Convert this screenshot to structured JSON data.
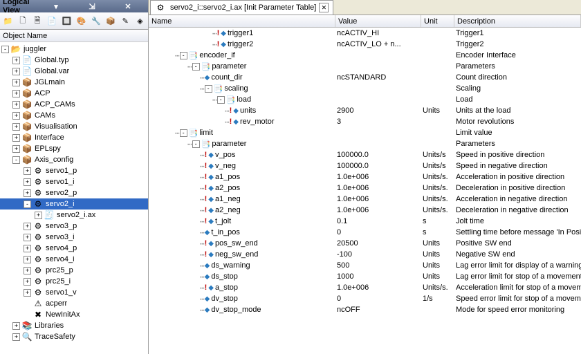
{
  "left": {
    "title": "Logical View",
    "headerTitle": "Object Name",
    "toolbarIcons": [
      "📁",
      "🗋",
      "🗎",
      "📄",
      "🔲",
      "🎨",
      "🔧",
      "📦",
      "✎",
      "◈"
    ],
    "tree": [
      {
        "depth": 0,
        "exp": "-",
        "kind": "folder",
        "label": "juggler"
      },
      {
        "depth": 1,
        "exp": "+",
        "kind": "file",
        "label": "Global.typ"
      },
      {
        "depth": 1,
        "exp": "+",
        "kind": "file",
        "label": "Global.var"
      },
      {
        "depth": 1,
        "exp": "+",
        "kind": "pkg",
        "label": "JGLmain"
      },
      {
        "depth": 1,
        "exp": "+",
        "kind": "pkg",
        "label": "ACP"
      },
      {
        "depth": 1,
        "exp": "+",
        "kind": "pkg",
        "label": "ACP_CAMs"
      },
      {
        "depth": 1,
        "exp": "+",
        "kind": "pkg",
        "label": "CAMs"
      },
      {
        "depth": 1,
        "exp": "+",
        "kind": "pkg",
        "label": "Visualisation"
      },
      {
        "depth": 1,
        "exp": "+",
        "kind": "pkg",
        "label": "Interface"
      },
      {
        "depth": 1,
        "exp": "+",
        "kind": "pkg",
        "label": "EPLspy"
      },
      {
        "depth": 1,
        "exp": "-",
        "kind": "pkg",
        "label": "Axis_config"
      },
      {
        "depth": 2,
        "exp": "+",
        "kind": "axis-p",
        "label": "servo1_p"
      },
      {
        "depth": 2,
        "exp": "+",
        "kind": "axis-i",
        "label": "servo1_i"
      },
      {
        "depth": 2,
        "exp": "+",
        "kind": "axis-p",
        "label": "servo2_p"
      },
      {
        "depth": 2,
        "exp": "-",
        "kind": "axis-i",
        "label": "servo2_i",
        "sel": true
      },
      {
        "depth": 3,
        "exp": "+",
        "kind": "ax",
        "label": "servo2_i.ax"
      },
      {
        "depth": 2,
        "exp": "+",
        "kind": "axis-p",
        "label": "servo3_p"
      },
      {
        "depth": 2,
        "exp": "+",
        "kind": "axis-i",
        "label": "servo3_i"
      },
      {
        "depth": 2,
        "exp": "+",
        "kind": "axis-p",
        "label": "servo4_p"
      },
      {
        "depth": 2,
        "exp": "+",
        "kind": "axis-i",
        "label": "servo4_i"
      },
      {
        "depth": 2,
        "exp": "+",
        "kind": "axis-p",
        "label": "prc25_p"
      },
      {
        "depth": 2,
        "exp": "+",
        "kind": "axis-i",
        "label": "prc25_i"
      },
      {
        "depth": 2,
        "exp": "+",
        "kind": "axis-i",
        "label": "servo1_v"
      },
      {
        "depth": 2,
        "exp": "",
        "kind": "warn",
        "label": "acperr"
      },
      {
        "depth": 2,
        "exp": "",
        "kind": "err",
        "label": "NewInitAx"
      },
      {
        "depth": 1,
        "exp": "+",
        "kind": "lib",
        "label": "Libraries"
      },
      {
        "depth": 1,
        "exp": "+",
        "kind": "trace",
        "label": "TraceSafety"
      }
    ]
  },
  "right": {
    "tabTitle": "servo2_i::servo2_i.ax [Init Parameter Table]",
    "columns": {
      "name": "Name",
      "value": "Value",
      "unit": "Unit",
      "desc": "Description"
    },
    "rows": [
      {
        "ind": 5,
        "mark": "!",
        "type": "val",
        "name": "trigger1",
        "value": "ncACTIV_HI",
        "unit": "",
        "desc": "Trigger1"
      },
      {
        "ind": 5,
        "mark": "!",
        "type": "val",
        "name": "trigger2",
        "value": "ncACTIV_LO + n...",
        "unit": "",
        "desc": "Trigger2"
      },
      {
        "ind": 2,
        "mark": "",
        "type": "struct",
        "exp": "-",
        "name": "encoder_if",
        "value": "",
        "unit": "",
        "desc": "Encoder Interface"
      },
      {
        "ind": 3,
        "mark": "",
        "type": "struct",
        "exp": "-",
        "name": "parameter",
        "value": "",
        "unit": "",
        "desc": "Parameters"
      },
      {
        "ind": 4,
        "mark": "",
        "type": "val",
        "name": "count_dir",
        "value": "ncSTANDARD",
        "unit": "",
        "desc": "Count direction"
      },
      {
        "ind": 4,
        "mark": "",
        "type": "struct",
        "exp": "-",
        "name": "scaling",
        "value": "",
        "unit": "",
        "desc": "Scaling"
      },
      {
        "ind": 5,
        "mark": "",
        "type": "struct",
        "exp": "-",
        "name": "load",
        "value": "",
        "unit": "",
        "desc": "Load"
      },
      {
        "ind": 6,
        "mark": "!",
        "type": "val",
        "name": "units",
        "value": "2900",
        "unit": "Units",
        "desc": "Units at the load"
      },
      {
        "ind": 6,
        "mark": "!",
        "type": "val",
        "name": "rev_motor",
        "value": "3",
        "unit": "",
        "desc": "Motor revolutions"
      },
      {
        "ind": 2,
        "mark": "",
        "type": "struct",
        "exp": "-",
        "name": "limit",
        "value": "",
        "unit": "",
        "desc": "Limit value"
      },
      {
        "ind": 3,
        "mark": "",
        "type": "struct",
        "exp": "-",
        "name": "parameter",
        "value": "",
        "unit": "",
        "desc": "Parameters"
      },
      {
        "ind": 4,
        "mark": "!",
        "type": "val",
        "name": "v_pos",
        "value": "100000.0",
        "unit": "Units/s",
        "desc": "Speed in positive direction"
      },
      {
        "ind": 4,
        "mark": "!",
        "type": "val",
        "name": "v_neg",
        "value": "100000.0",
        "unit": "Units/s",
        "desc": "Speed in negative direction"
      },
      {
        "ind": 4,
        "mark": "!",
        "type": "val",
        "name": "a1_pos",
        "value": "1.0e+006",
        "unit": "Units/s.",
        "desc": "Acceleration in positive direction"
      },
      {
        "ind": 4,
        "mark": "!",
        "type": "val",
        "name": "a2_pos",
        "value": "1.0e+006",
        "unit": "Units/s.",
        "desc": "Deceleration in positive direction"
      },
      {
        "ind": 4,
        "mark": "!",
        "type": "val",
        "name": "a1_neg",
        "value": "1.0e+006",
        "unit": "Units/s.",
        "desc": "Acceleration in negative direction"
      },
      {
        "ind": 4,
        "mark": "!",
        "type": "val",
        "name": "a2_neg",
        "value": "1.0e+006",
        "unit": "Units/s.",
        "desc": "Deceleration in negative direction"
      },
      {
        "ind": 4,
        "mark": "!",
        "type": "val",
        "name": "t_jolt",
        "value": "0.1",
        "unit": "s",
        "desc": "Jolt time"
      },
      {
        "ind": 4,
        "mark": "",
        "type": "val",
        "name": "t_in_pos",
        "value": "0",
        "unit": "s",
        "desc": "Settling time before message 'In Position'"
      },
      {
        "ind": 4,
        "mark": "!",
        "type": "val",
        "name": "pos_sw_end",
        "value": "20500",
        "unit": "Units",
        "desc": "Positive SW end"
      },
      {
        "ind": 4,
        "mark": "!",
        "type": "val",
        "name": "neg_sw_end",
        "value": "-100",
        "unit": "Units",
        "desc": "Negative SW end"
      },
      {
        "ind": 4,
        "mark": "",
        "type": "val",
        "name": "ds_warning",
        "value": "500",
        "unit": "Units",
        "desc": "Lag error limit for display of a warning"
      },
      {
        "ind": 4,
        "mark": "",
        "type": "val",
        "name": "ds_stop",
        "value": "1000",
        "unit": "Units",
        "desc": "Lag error limit for stop of a movement"
      },
      {
        "ind": 4,
        "mark": "!",
        "type": "val",
        "name": "a_stop",
        "value": "1.0e+006",
        "unit": "Units/s.",
        "desc": "Acceleration limit for stop of a movement"
      },
      {
        "ind": 4,
        "mark": "",
        "type": "val",
        "name": "dv_stop",
        "value": "0",
        "unit": "1/s",
        "desc": "Speed error limit for stop of a movement"
      },
      {
        "ind": 4,
        "mark": "",
        "type": "val",
        "name": "dv_stop_mode",
        "value": "ncOFF",
        "unit": "",
        "desc": "Mode for speed error monitoring"
      }
    ]
  }
}
